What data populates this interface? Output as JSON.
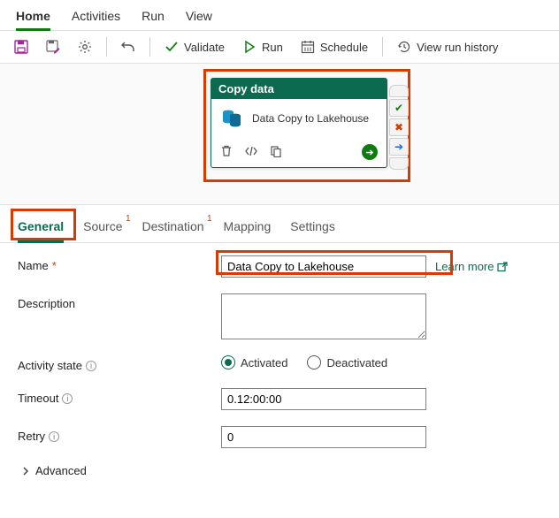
{
  "topTabs": {
    "home": "Home",
    "activities": "Activities",
    "run": "Run",
    "view": "View"
  },
  "toolbar": {
    "validate": "Validate",
    "run": "Run",
    "schedule": "Schedule",
    "history": "View run history"
  },
  "node": {
    "header": "Copy data",
    "title": "Data Copy to Lakehouse"
  },
  "panelTabs": {
    "general": "General",
    "source": "Source",
    "destination": "Destination",
    "mapping": "Mapping",
    "settings": "Settings",
    "err": "1"
  },
  "form": {
    "nameLabel": "Name",
    "nameValue": "Data Copy to Lakehouse",
    "learnMore": "Learn more",
    "descLabel": "Description",
    "descValue": "",
    "stateLabel": "Activity state",
    "activated": "Activated",
    "deactivated": "Deactivated",
    "timeoutLabel": "Timeout",
    "timeoutValue": "0.12:00:00",
    "retryLabel": "Retry",
    "retryValue": "0",
    "advanced": "Advanced"
  }
}
